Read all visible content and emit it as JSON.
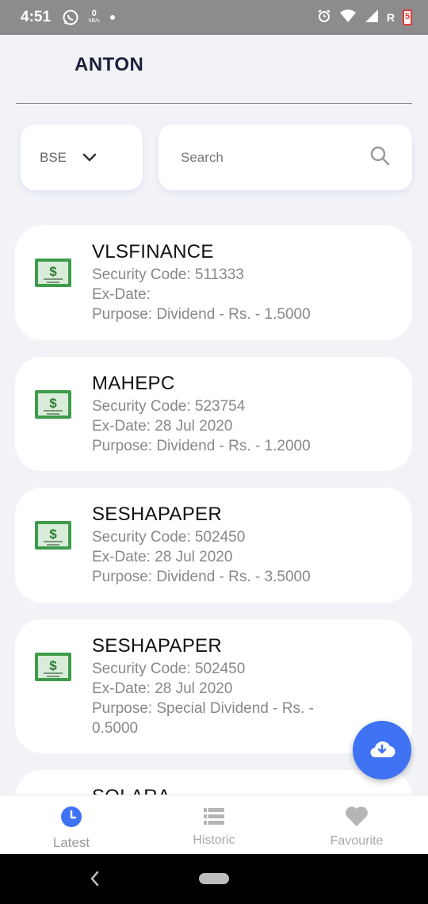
{
  "status_bar": {
    "time": "4:51",
    "net_speed_value": "0",
    "net_speed_unit": "kB/s",
    "roaming": "R",
    "battery": "5",
    "icons": [
      "whatsapp-icon",
      "network-speed-icon",
      "notification-dot-icon",
      "alarm-icon",
      "wifi-icon",
      "signal-icon",
      "battery-icon"
    ]
  },
  "header": {
    "title": "ANTON"
  },
  "filters": {
    "exchange": {
      "value": "BSE",
      "icon": "chevron-down-icon"
    },
    "search": {
      "placeholder": "Search",
      "value": "",
      "icon": "search-icon"
    }
  },
  "list": {
    "items": [
      {
        "name": "VLSFINANCE",
        "security_code": "Security Code: 511333",
        "ex_date": "Ex-Date:",
        "purpose": "Purpose: Dividend - Rs. - 1.5000",
        "icon": "money-icon"
      },
      {
        "name": "MAHEPC",
        "security_code": "Security Code: 523754",
        "ex_date": "Ex-Date: 28 Jul 2020",
        "purpose": "Purpose: Dividend - Rs. - 1.2000",
        "icon": "money-icon"
      },
      {
        "name": "SESHAPAPER",
        "security_code": "Security Code: 502450",
        "ex_date": "Ex-Date: 28 Jul 2020",
        "purpose": "Purpose: Dividend - Rs. - 3.5000",
        "icon": "money-icon"
      },
      {
        "name": "SESHAPAPER",
        "security_code": "Security Code: 502450",
        "ex_date": "Ex-Date: 28 Jul 2020",
        "purpose": "Purpose: Special Dividend - Rs. - 0.5000",
        "icon": "money-icon"
      },
      {
        "name": "SOLARA"
      }
    ]
  },
  "fab": {
    "icon": "cloud-download-icon"
  },
  "bottom_nav": {
    "items": [
      {
        "label": "Latest",
        "icon": "clock-icon",
        "active": true
      },
      {
        "label": "Historic",
        "icon": "list-icon",
        "active": false
      },
      {
        "label": "Favourite",
        "icon": "heart-icon",
        "active": false
      }
    ]
  },
  "colors": {
    "accent": "#3F73F3",
    "background": "#F2F3F7",
    "card": "#FFFFFF",
    "title_text": "#1E1F3B",
    "secondary_text": "#888888",
    "money_green": "#3E9B4A",
    "status_bar": "#8C8C8C"
  }
}
